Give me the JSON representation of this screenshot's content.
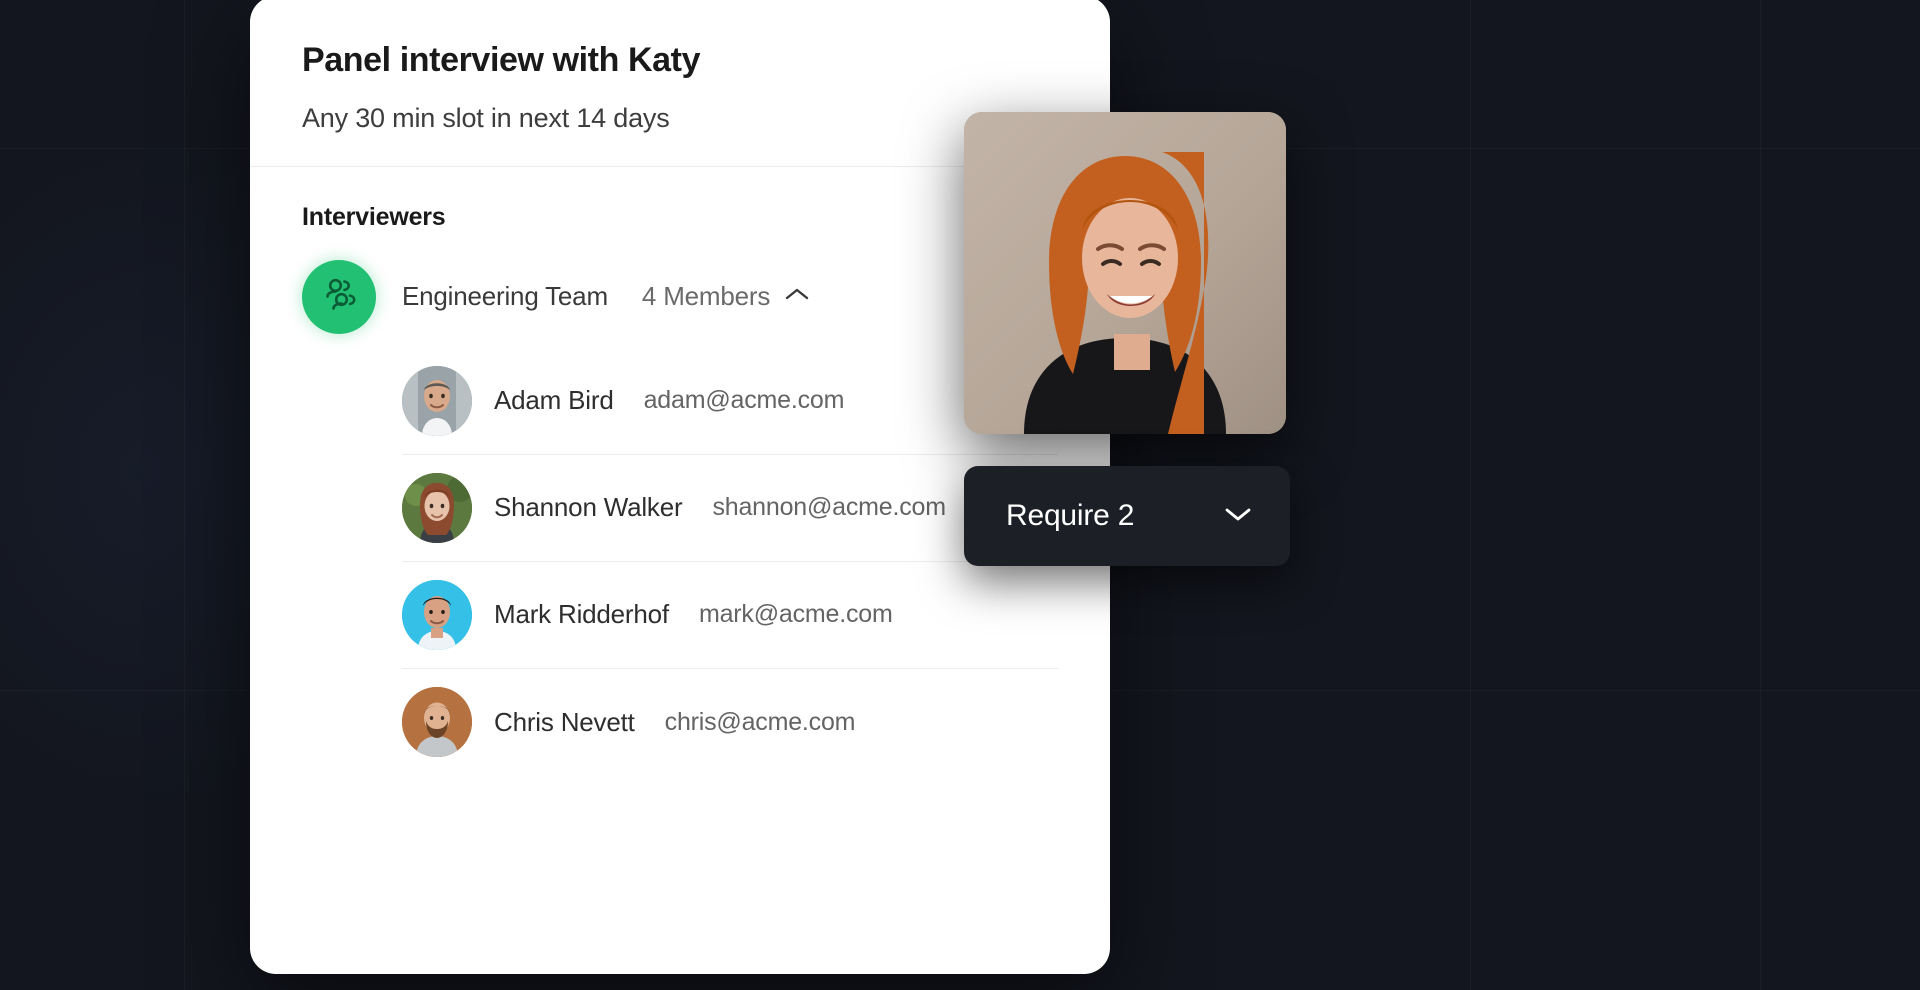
{
  "background": {
    "color": "#13161e"
  },
  "card": {
    "title": "Panel interview with Katy",
    "subtitle": "Any 30 min slot in next 14 days",
    "section_label": "Interviewers",
    "team": {
      "avatar_icon": "group-people-icon",
      "avatar_color": "#22c073",
      "name": "Engineering Team",
      "members_count_label": "4 Members",
      "toggle_icon": "chevron-up-icon",
      "expanded": true
    },
    "members": [
      {
        "name": "Adam Bird",
        "email": "adam@acme.com",
        "avatar_name": "avatar-adam-bird",
        "avatar_bg": "#9aa3a8",
        "hair": "#5d5a55",
        "skin": "#d8a98b",
        "shirt": "#f2f4f6"
      },
      {
        "name": "Shannon Walker",
        "email": "shannon@acme.com",
        "avatar_name": "avatar-shannon-walker",
        "avatar_bg": "#5c7a3f",
        "hair": "#8c4a2f",
        "skin": "#e8c3ab",
        "shirt": "#3a3f45"
      },
      {
        "name": "Mark Ridderhof",
        "email": "mark@acme.com",
        "avatar_name": "avatar-mark-ridderhof",
        "avatar_bg": "#35c0e8",
        "hair": "#241d18",
        "skin": "#d9a184",
        "shirt": "#eef3f7"
      },
      {
        "name": "Chris Nevett",
        "email": "chris@acme.com",
        "avatar_name": "avatar-chris-nevett",
        "avatar_bg": "#b5713f",
        "hair": "#6b4326",
        "skin": "#e0b291",
        "shirt": "#c3c7c9"
      }
    ]
  },
  "video": {
    "name": "video-thumbnail-katy",
    "background_color": "#b7a99c",
    "hair_color": "#c4601f",
    "skin_color": "#e8b69b",
    "top_color": "#17171a"
  },
  "require_dropdown": {
    "label": "Require 2",
    "icon": "chevron-down-icon",
    "background": "#1c1f26",
    "text_color": "#ffffff"
  }
}
